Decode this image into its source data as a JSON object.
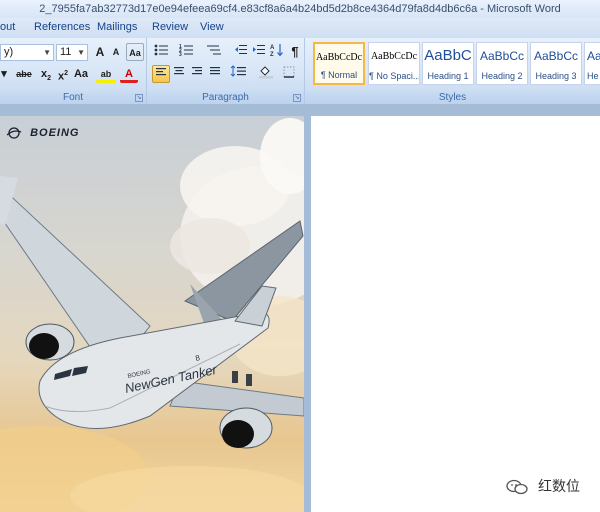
{
  "window": {
    "title": "2_7955fa7ab32773d17e0e94efeea69cf4.e83cf8a6a4b24bd5d2b8ce4364d79fa8d4db6c6a - Microsoft Word"
  },
  "tabs": [
    "out",
    "References",
    "Mailings",
    "Review",
    "View"
  ],
  "font_group": {
    "label": "Font",
    "font_name": "y)",
    "font_size": "11",
    "buttons": {
      "grow": "A",
      "shrink": "A",
      "clear": "Aa",
      "strike": "abe",
      "subscript": "x",
      "superscript": "x",
      "change_case": "Aa",
      "highlight": "ab",
      "font_color": "A"
    }
  },
  "paragraph_group": {
    "label": "Paragraph",
    "buttons": {
      "show_marks": "¶"
    }
  },
  "styles_group": {
    "label": "Styles",
    "items": [
      {
        "sample": "AaBbCcDc",
        "name": "¶ Normal",
        "kind": "normal"
      },
      {
        "sample": "AaBbCcDc",
        "name": "¶ No Spaci...",
        "kind": "normal"
      },
      {
        "sample": "AaBbC",
        "name": "Heading 1",
        "kind": "h1"
      },
      {
        "sample": "AaBbCc",
        "name": "Heading 2",
        "kind": "h"
      },
      {
        "sample": "AaBbCc",
        "name": "Heading 3",
        "kind": "h"
      },
      {
        "sample": "Aa",
        "name": "He",
        "kind": "h"
      }
    ]
  },
  "document": {
    "image": {
      "logo_text": "BOEING",
      "aircraft_text_1": "NewGen Tanker",
      "aircraft_text_2": "BOEING",
      "aircraft_number": "8"
    },
    "watermark": "红数位"
  },
  "colors": {
    "accent": "#f4b847",
    "ribbon": "#d7e5f6",
    "workspace": "#a5bcd7"
  }
}
